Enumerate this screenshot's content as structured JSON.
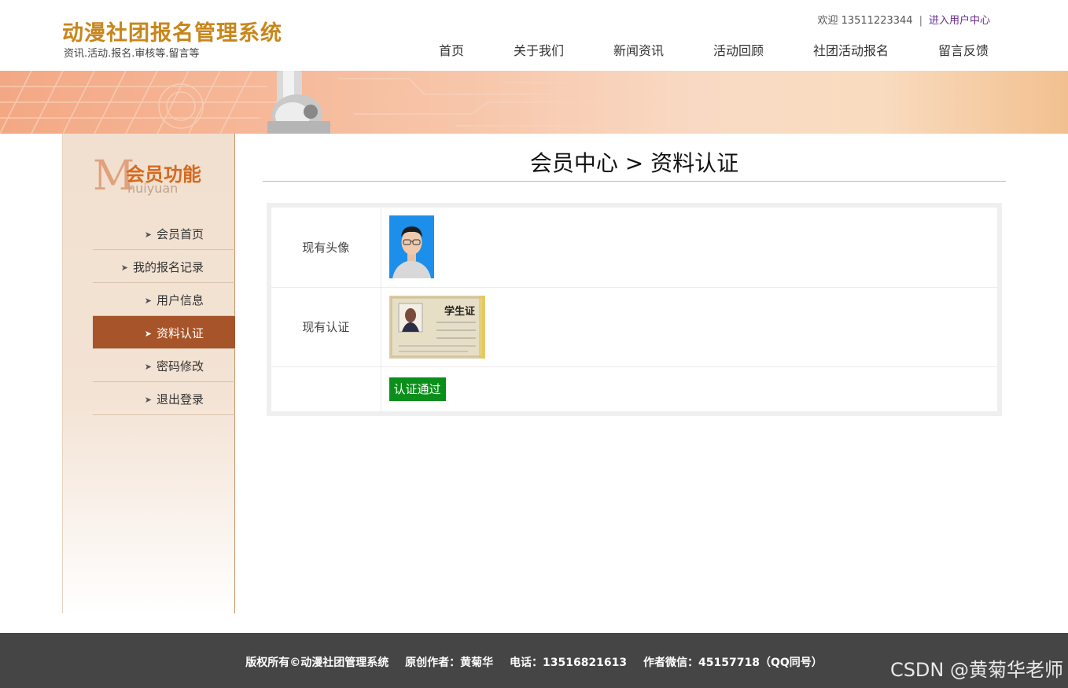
{
  "header": {
    "title": "动漫社团报名管理系统",
    "subtitle": "资讯.活动.报名.审核等.留言等",
    "welcome": "欢迎 13511223344",
    "separator": "|",
    "user_center_link": "进入用户中心"
  },
  "nav": {
    "items": [
      {
        "label": "首页"
      },
      {
        "label": "关于我们"
      },
      {
        "label": "新闻资讯"
      },
      {
        "label": "活动回顾"
      },
      {
        "label": "社团活动报名"
      },
      {
        "label": "留言反馈"
      }
    ]
  },
  "sidebar": {
    "logo_letter": "M",
    "logo_title": "会员功能",
    "logo_pinyin": "huiyuan",
    "items": [
      {
        "label": "会员首页",
        "active": false
      },
      {
        "label": "我的报名记录",
        "active": false
      },
      {
        "label": "用户信息",
        "active": false
      },
      {
        "label": "资料认证",
        "active": true
      },
      {
        "label": "密码修改",
        "active": false
      },
      {
        "label": "退出登录",
        "active": false
      }
    ],
    "arrow_icon": "chevron-right-icon"
  },
  "main": {
    "title": "会员中心 > 资料认证",
    "rows": [
      {
        "label": "现有头像",
        "content": "avatar-image"
      },
      {
        "label": "现有认证",
        "content": "student-card-image"
      },
      {
        "label": "",
        "content": "status"
      }
    ],
    "student_card_text": "学生证",
    "status_label": "认证通过",
    "status_color": "#0a8f1a"
  },
  "footer": {
    "copyright": "版权所有©动漫社团管理系统",
    "author": "原创作者：黄菊华",
    "phone": "电话：13516821613",
    "wechat": "作者微信：45157718（QQ同号）"
  },
  "watermark": "CSDN @黄菊华老师",
  "colors": {
    "brand": "#c8861a",
    "sidebar_active": "#a8542a",
    "footer_bg": "#454545",
    "link_purple": "#6a2c91"
  }
}
